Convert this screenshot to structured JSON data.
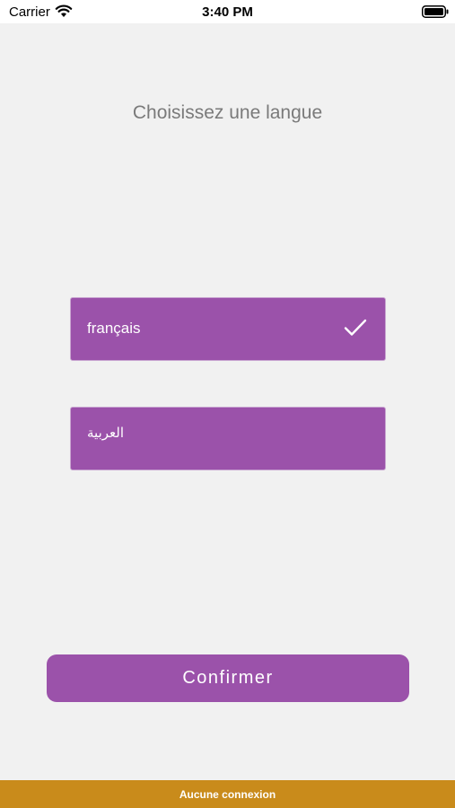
{
  "status_bar": {
    "carrier": "Carrier",
    "time": "3:40 PM",
    "wifi_icon": "wifi-icon",
    "battery_icon": "battery-icon"
  },
  "screen": {
    "title": "Choisissez une langue"
  },
  "languages": [
    {
      "label": "français",
      "selected": true
    },
    {
      "label": "العربية",
      "selected": false
    }
  ],
  "confirm_label": "Confirmer",
  "banner": {
    "text": "Aucune connexion"
  },
  "colors": {
    "accent": "#9b52aa",
    "background": "#f1f1f1",
    "banner": "#c98b1b",
    "title": "#7a7a7a"
  }
}
